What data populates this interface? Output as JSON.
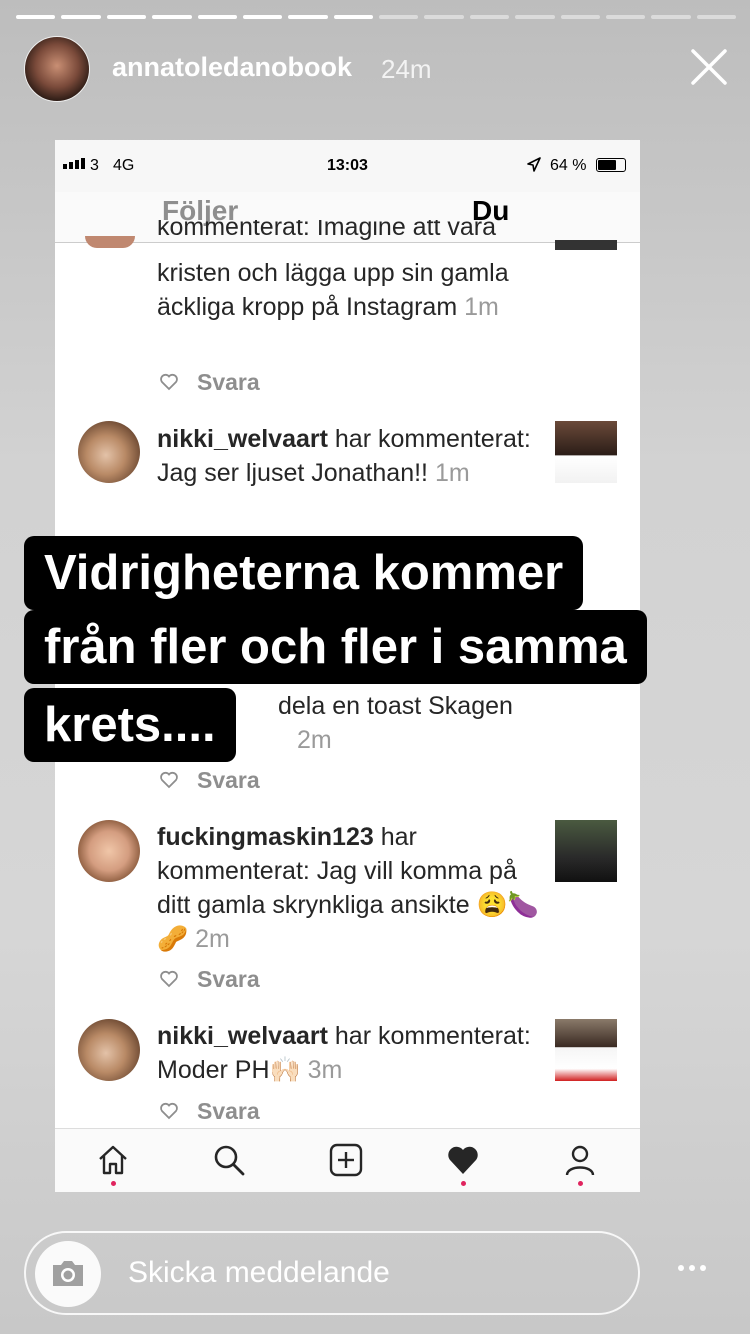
{
  "story": {
    "segments_total": 16,
    "segments_done": 8,
    "username": "annatoledanobook",
    "time": "24m"
  },
  "status_bar": {
    "carrier": "3",
    "network": "4G",
    "time": "13:03",
    "battery": "64 %",
    "battery_level": 0.64
  },
  "tabs": {
    "following": "Följer",
    "you": "Du"
  },
  "comments": [
    {
      "cut_line": "kommenterat: Imagine att vara",
      "text": "kristen och lägga upp sin gamla äckliga kropp på Instagram",
      "time": "1m",
      "reply": "Svara"
    },
    {
      "username": "nikki_welvaart",
      "text": " har kommenterat: Jag ser ljuset Jonathan!!",
      "time": "1m"
    },
    {
      "text": "dela en toast Skagen",
      "time": "2m",
      "reply": "Svara"
    },
    {
      "username": "fuckingmaskin123",
      "text": " har kommenterat: Jag vill komma på ditt gamla skrynkliga ansikte 😩🍆🥜",
      "time": "2m",
      "reply": "Svara"
    },
    {
      "username": "nikki_welvaart",
      "text": " har kommenterat: Moder PH🙌🏻",
      "time": "3m",
      "reply": "Svara"
    }
  ],
  "caption": {
    "line1": "Vidrigheterna kommer",
    "line2": "från fler och fler i samma",
    "line3": "krets...."
  },
  "nav": [
    "home-icon",
    "search-icon",
    "add-icon",
    "heart-icon",
    "profile-icon"
  ],
  "message_bar": {
    "placeholder": "Skicka meddelande"
  },
  "colors": {
    "accent_dot": "#e0245e",
    "caption_bg": "#000000"
  }
}
